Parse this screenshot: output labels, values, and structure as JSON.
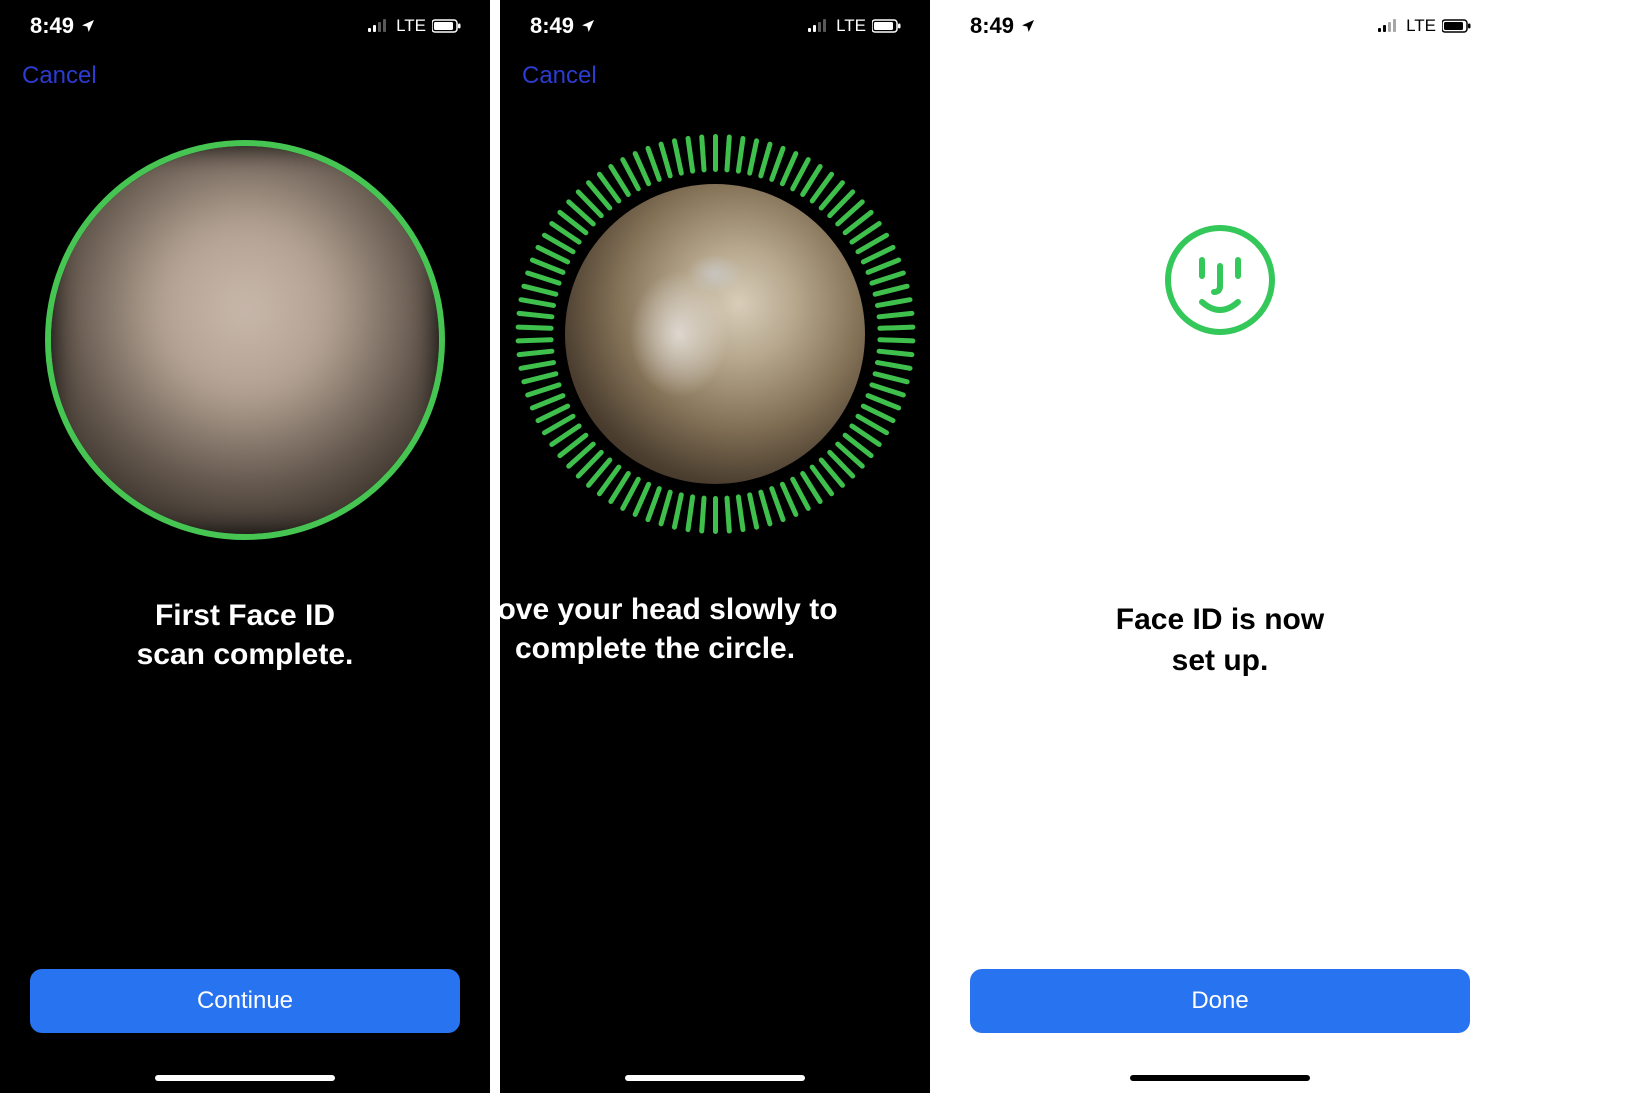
{
  "status": {
    "time": "8:49",
    "network": "LTE"
  },
  "nav": {
    "cancel_label": "Cancel"
  },
  "screen1": {
    "instruction": "First Face ID\nscan complete.",
    "cta": "Continue"
  },
  "screen2": {
    "instruction": "Move your head slowly to\ncomplete the circle."
  },
  "screen3": {
    "instruction": "Face ID is now\nset up.",
    "cta": "Done"
  },
  "colors": {
    "accent_green": "#34c759",
    "primary_blue": "#2873f0",
    "link_blue": "#2c3bd1"
  }
}
